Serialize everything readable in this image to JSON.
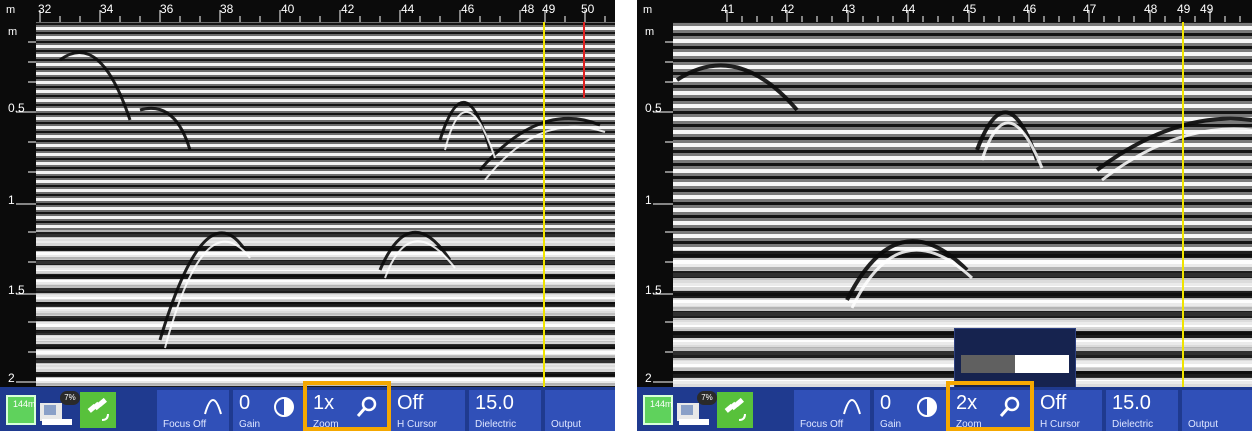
{
  "screens": [
    {
      "id": "left",
      "x_ticks": [
        "32",
        "34",
        "36",
        "38",
        "40",
        "42",
        "44",
        "46",
        "48",
        "49",
        "50"
      ],
      "x_unit": "m",
      "y_unit": "m",
      "y_ticks": [
        "0.5",
        "1",
        "1.5",
        "2"
      ],
      "battery_label": "144m",
      "device_percent": "7%",
      "focus_label": "Focus Off",
      "gain_value": "0",
      "gain_label": "Gain",
      "zoom_value": "1x",
      "zoom_label": "Zoom",
      "hcursor_value": "Off",
      "hcursor_label": "H Cursor",
      "dielectric_value": "15.0",
      "dielectric_label": "Dielectric",
      "output_label": "Output",
      "cursor_color": "#f0e400",
      "marker_color": "#e02020"
    },
    {
      "id": "right",
      "x_ticks": [
        "41",
        "42",
        "43",
        "44",
        "45",
        "46",
        "47",
        "48",
        "49",
        "49"
      ],
      "x_unit": "m",
      "y_unit": "m",
      "y_ticks": [
        "0.5",
        "1",
        "1.5",
        "2"
      ],
      "battery_label": "144m",
      "device_percent": "7%",
      "focus_label": "Focus Off",
      "gain_value": "0",
      "gain_label": "Gain",
      "zoom_value": "2x",
      "zoom_label": "Zoom",
      "hcursor_value": "Off",
      "hcursor_label": "H Cursor",
      "dielectric_value": "15.0",
      "dielectric_label": "Dielectric",
      "output_label": "Output",
      "cursor_color": "#f0e400",
      "zoom_popup_level": 0.5
    }
  ],
  "colors": {
    "taskbar": "#1f3a8f",
    "tile": "#3050b8",
    "highlight": "#f5a800"
  }
}
